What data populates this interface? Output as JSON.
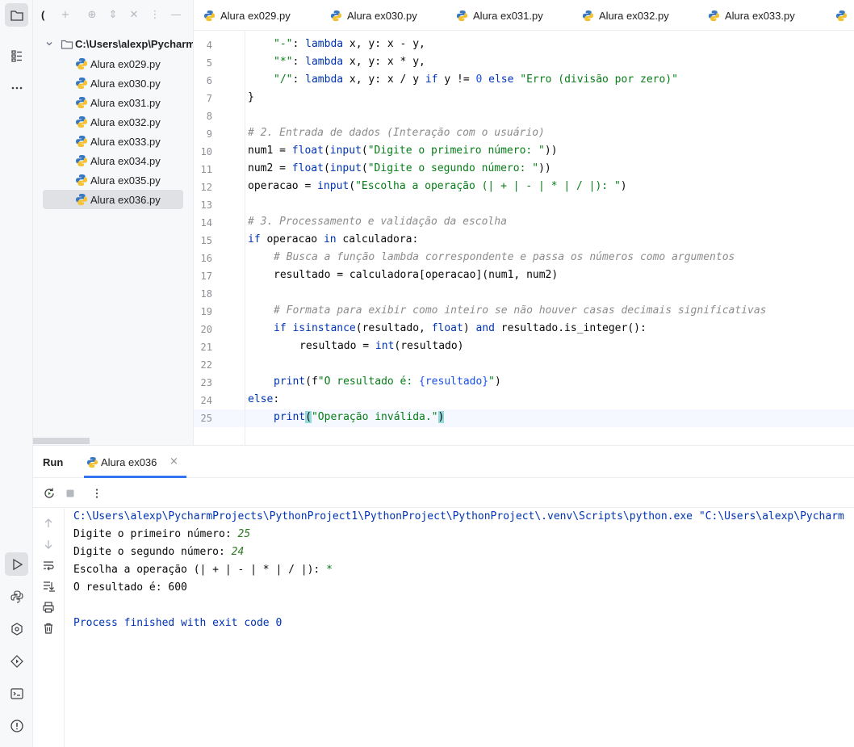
{
  "project_tree": {
    "root_label": "C:\\Users\\alexp\\Pycharm",
    "files": [
      "Alura ex029.py",
      "Alura ex030.py",
      "Alura ex031.py",
      "Alura ex032.py",
      "Alura ex033.py",
      "Alura ex034.py",
      "Alura ex035.py",
      "Alura ex036.py"
    ],
    "selected": "Alura ex036.py"
  },
  "tabs": [
    "Alura ex029.py",
    "Alura ex030.py",
    "Alura ex031.py",
    "Alura ex032.py",
    "Alura ex033.py"
  ],
  "editor": {
    "line_numbers": [
      "4",
      "5",
      "6",
      "7",
      "8",
      "9",
      "10",
      "11",
      "12",
      "13",
      "14",
      "15",
      "16",
      "17",
      "18",
      "19",
      "20",
      "21",
      "22",
      "23",
      "24",
      "25"
    ],
    "lines": {
      "l4_key": "\"-\"",
      "l4_rest": ": lambda x, y: x - y,",
      "l5_key": "\"*\"",
      "l5_rest": ": lambda x, y: x * y,",
      "l6_key": "\"/\"",
      "l6_mid": ": lambda x, y: x / y if y != 0 else ",
      "l6_str": "\"Erro (divisão por zero)\"",
      "l7": "}",
      "l9": "# 2. Entrada de dados (Interação com o usuário)",
      "l10_a": "num1 = float(input(",
      "l10_s": "\"Digite o primeiro número: \"",
      "l10_b": "))",
      "l11_a": "num2 = float(input(",
      "l11_s": "\"Digite o segundo número: \"",
      "l11_b": "))",
      "l12_a": "operacao = input(",
      "l12_s": "\"Escolha a operação (| + | - | * | / |): \"",
      "l12_b": ")",
      "l14": "# 3. Processamento e validação da escolha",
      "l15": "if operacao in calculadora:",
      "l16": "# Busca a função lambda correspondente e passa os números como argumentos",
      "l17": "resultado = calculadora[operacao](num1, num2)",
      "l19": "# Formata para exibir como inteiro se não houver casas decimais significativas",
      "l20": "if isinstance(resultado, float) and resultado.is_integer():",
      "l21": "resultado = int(resultado)",
      "l23_a": "print(f",
      "l23_s": "\"O resultado é: ",
      "l23_v": "{resultado}",
      "l23_e": "\"",
      "l23_b": ")",
      "l24": "else:",
      "l25_a": "print",
      "l25_p": "(",
      "l25_s": "\"Operação inválida.\"",
      "l25_c": ")"
    }
  },
  "run": {
    "title": "Run",
    "tab_label": "Alura ex036",
    "console": {
      "cmd": "C:\\Users\\alexp\\PycharmProjects\\PythonProject1\\PythonProject\\PythonProject\\.venv\\Scripts\\python.exe \"C:\\Users\\alexp\\Pycharm",
      "p1": "Digite o primeiro número: ",
      "v1": "25",
      "p2": "Digite o segundo número: ",
      "v2": "24",
      "p3": "Escolha a operação (| + | - | * | / |): ",
      "v3": "*",
      "out": "O resultado é: 600",
      "exit": "Process finished with exit code 0"
    }
  },
  "colors": {
    "keyword": "#0033b3",
    "string": "#067d17",
    "number": "#1750eb",
    "comment": "#8c8c8c",
    "accent": "#3574f0"
  },
  "icons": [
    "folder-icon",
    "structure-icon",
    "more-icon",
    "run-icon",
    "python-packages-icon",
    "services-icon",
    "run-config-icon",
    "terminal-icon",
    "problems-icon",
    "python-file-icon"
  ]
}
